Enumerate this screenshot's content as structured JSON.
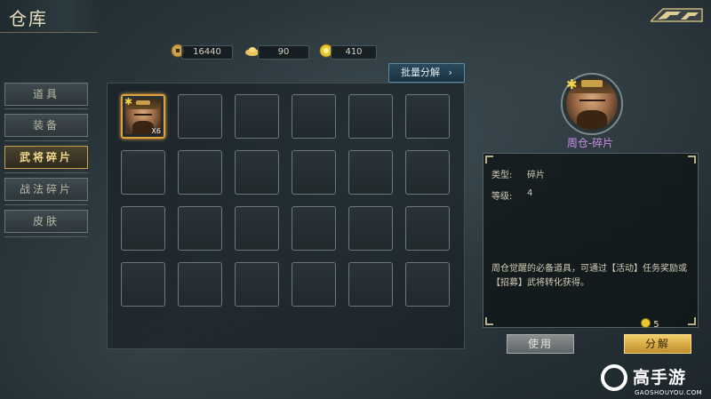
{
  "header": {
    "title": "仓库",
    "back_icon": "back-arrow-icon"
  },
  "currencies": [
    {
      "icon": "copper-coin-icon",
      "value": "16440"
    },
    {
      "icon": "gold-ingot-icon",
      "value": "90"
    },
    {
      "icon": "jade-coin-icon",
      "value": "410"
    }
  ],
  "batch_decompose_label": "批量分解",
  "batch_decompose_icon": "chevron-right-icon",
  "tabs": [
    {
      "label": "道具",
      "active": false
    },
    {
      "label": "装备",
      "active": false
    },
    {
      "label": "武将碎片",
      "active": true
    },
    {
      "label": "战法碎片",
      "active": false
    },
    {
      "label": "皮肤",
      "active": false
    }
  ],
  "grid": {
    "rows": 4,
    "cols": 6,
    "items": [
      {
        "slot": 0,
        "icon": "hero-fragment-icon",
        "name": "周仓",
        "count_label": "X6",
        "selected": true
      }
    ]
  },
  "detail": {
    "name": "周仓-碎片",
    "type_label": "类型:",
    "type_value": "碎片",
    "level_label": "等级:",
    "level_value": "4",
    "description": "周仓觉醒的必备道具，可通过【活动】任务奖励或【招募】武将转化获得。",
    "cost_value": "5",
    "use_button": "使用",
    "decompose_button": "分解"
  },
  "watermark": {
    "title": "高手游",
    "subtitle": "GAOSHOUYOU.COM"
  },
  "colors": {
    "accent_gold": "#e3a23a",
    "name_purple": "#c98fe8",
    "button_gold": "#f2cf6a"
  }
}
